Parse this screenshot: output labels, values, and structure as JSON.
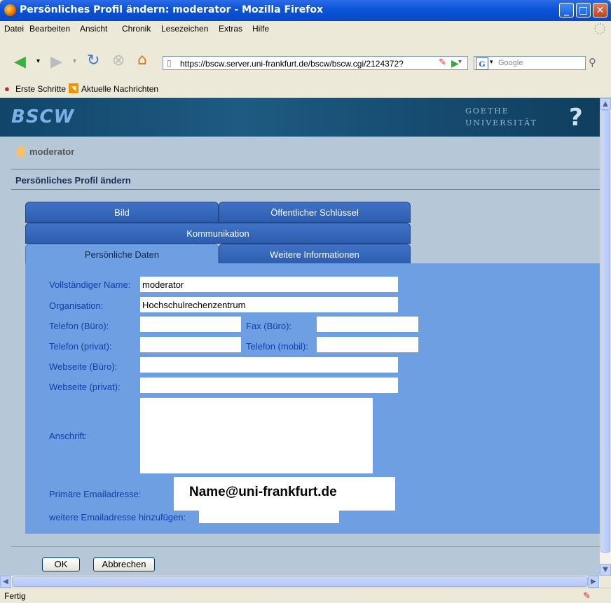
{
  "window": {
    "title": "Persönliches Profil ändern: moderator - Mozilla Firefox"
  },
  "menu": [
    "Datei",
    "Bearbeiten",
    "Ansicht",
    "Chronik",
    "Lesezeichen",
    "Extras",
    "Hilfe"
  ],
  "nav": {
    "url": "https://bscw.server.uni-frankfurt.de/bscw/bscw.cgi/2124372?",
    "search_placeholder": "Google",
    "search_engine_glyph": "G"
  },
  "bookmarks": [
    "Erste Schritte",
    "Aktuelle Nachrichten"
  ],
  "header": {
    "logo": "BSCW",
    "university_line1": "GOETHE",
    "university_line2": "UNIVERSITÄT",
    "help": "?"
  },
  "user": {
    "name": "moderator"
  },
  "page": {
    "title": "Persönliches Profil ändern"
  },
  "tabs": {
    "bild": "Bild",
    "schluessel": "Öffentlicher Schlüssel",
    "kommunikation": "Kommunikation",
    "persoenlich": "Persönliche Daten",
    "weitere": "Weitere Informationen"
  },
  "form": {
    "fullname_label": "Vollständiger Name:",
    "fullname_value": "moderator",
    "org_label": "Organisation:",
    "org_value": "Hochschulrechenzentrum",
    "tel_office_label": "Telefon (Büro):",
    "fax_office_label": "Fax (Büro):",
    "tel_private_label": "Telefon (privat):",
    "tel_mobile_label": "Telefon (mobil):",
    "web_office_label": "Webseite (Büro):",
    "web_private_label": "Webseite (privat):",
    "address_label": "Anschrift:",
    "primary_email_label": "Primäre Emailadresse:",
    "primary_email_value": "Name@uni-frankfurt.de",
    "add_email_label": "weitere Emailadresse hinzufügen:"
  },
  "buttons": {
    "ok": "OK",
    "cancel": "Abbrechen"
  },
  "status": {
    "text": "Fertig"
  }
}
